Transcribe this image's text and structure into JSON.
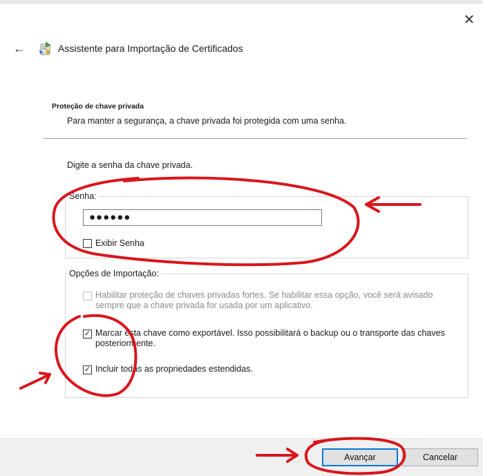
{
  "window": {
    "title": "Assistente para Importação de Certificados",
    "close_symbol": "✕",
    "back_symbol": "←"
  },
  "section": {
    "title": "Proteção de chave privada",
    "description": "Para manter a segurança, a chave privada foi protegida com uma senha."
  },
  "password": {
    "prompt": "Digite a senha da chave privada.",
    "group_label": "Senha:",
    "value": "●●●●●●",
    "show_label": "Exibir Senha",
    "show_checked": false
  },
  "import_options": {
    "group_label": "Opções de Importação:",
    "options": [
      {
        "label": "Habilitar proteção de chaves privadas fortes. Se habilitar essa opção, você será avisado sempre que a chave privada for usada por um aplicativo.",
        "checked": false,
        "enabled": false
      },
      {
        "label": "Marcar esta chave como exportável. Isso possibilitará o backup ou o transporte das chaves posteriormente.",
        "checked": true,
        "enabled": true
      },
      {
        "label": "Incluir todas as propriedades estendidas.",
        "checked": true,
        "enabled": true
      }
    ]
  },
  "buttons": {
    "next_label": "Avançar",
    "cancel_label": "Cancelar"
  },
  "icons": {
    "close": "close-icon",
    "back": "back-arrow-icon",
    "wizard": "certificate-wizard-icon",
    "check": "checkmark-icon"
  },
  "colors": {
    "accent": "#0078d7",
    "annotation": "#d8161b",
    "footer_bg": "#f0f0f0",
    "button_bg": "#e1e1e1"
  }
}
